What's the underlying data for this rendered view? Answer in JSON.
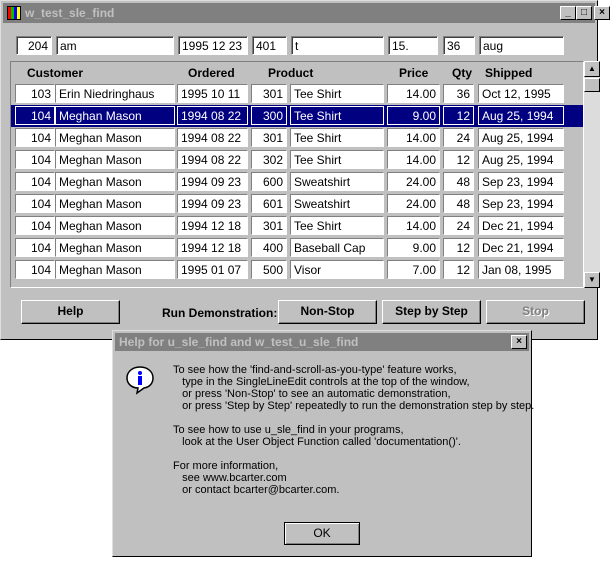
{
  "window": {
    "title": "w_test_sle_find",
    "minimize_label": "_",
    "maximize_label": "□",
    "close_label": "×"
  },
  "filters": [
    "204",
    "am",
    "1995 12 23",
    "401",
    "t",
    "15.",
    "36",
    "aug"
  ],
  "table": {
    "columns": [
      "Customer",
      "Ordered",
      "Product",
      "Price",
      "Qty",
      "Shipped"
    ],
    "rows": [
      [
        "103",
        "Erin Niedringhaus",
        "1995 10 11",
        "301",
        "Tee Shirt",
        "14.00",
        "36",
        "Oct 12, 1995"
      ],
      [
        "104",
        "Meghan Mason",
        "1994 08 22",
        "300",
        "Tee Shirt",
        "9.00",
        "12",
        "Aug 25, 1994"
      ],
      [
        "104",
        "Meghan Mason",
        "1994 08 22",
        "301",
        "Tee Shirt",
        "14.00",
        "24",
        "Aug 25, 1994"
      ],
      [
        "104",
        "Meghan Mason",
        "1994 08 22",
        "302",
        "Tee Shirt",
        "14.00",
        "12",
        "Aug 25, 1994"
      ],
      [
        "104",
        "Meghan Mason",
        "1994 09 23",
        "600",
        "Sweatshirt",
        "24.00",
        "48",
        "Sep 23, 1994"
      ],
      [
        "104",
        "Meghan Mason",
        "1994 09 23",
        "601",
        "Sweatshirt",
        "24.00",
        "48",
        "Sep 23, 1994"
      ],
      [
        "104",
        "Meghan Mason",
        "1994 12 18",
        "301",
        "Tee Shirt",
        "14.00",
        "24",
        "Dec 21, 1994"
      ],
      [
        "104",
        "Meghan Mason",
        "1994 12 18",
        "400",
        "Baseball Cap",
        "9.00",
        "12",
        "Dec 21, 1994"
      ],
      [
        "104",
        "Meghan Mason",
        "1995 01 07",
        "500",
        "Visor",
        "7.00",
        "12",
        "Jan 08, 1995"
      ]
    ],
    "selected_row": 1
  },
  "buttons": {
    "help": "Help",
    "run_label": "Run Demonstration:",
    "non_stop": "Non-Stop",
    "step": "Step by Step",
    "stop": "Stop"
  },
  "dialog": {
    "title": "Help for u_sle_find and w_test_u_sle_find",
    "close_label": "×",
    "icon": "info-icon",
    "lines": [
      "To see how the 'find-and-scroll-as-you-type' feature works,",
      "   type in the SingleLineEdit controls at the top of the window,",
      "   or press 'Non-Stop' to see an automatic demonstration,",
      "   or press 'Step by Step' repeatedly to run the demonstration step by step.",
      "",
      "To see how to use u_sle_find in your programs,",
      "   look at the User Object Function called 'documentation()'.",
      "",
      "For more information,",
      "   see www.bcarter.com",
      "   or contact bcarter@bcarter.com."
    ],
    "ok": "OK"
  }
}
